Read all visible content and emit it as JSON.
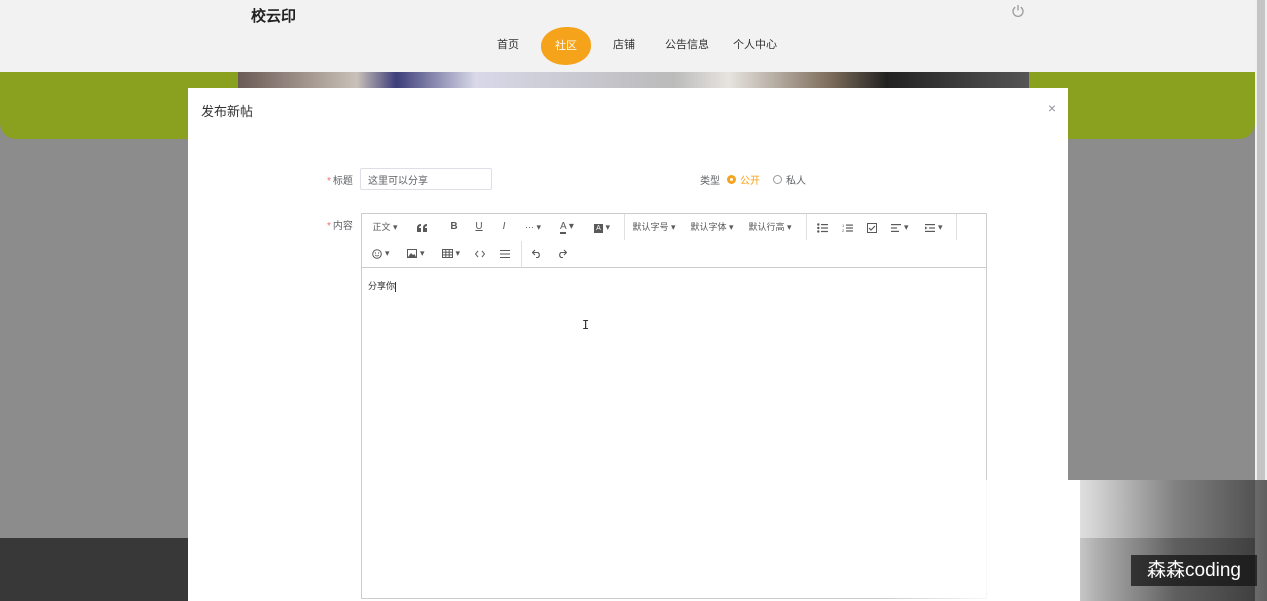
{
  "site": {
    "brand": "校云印",
    "nav": [
      {
        "label": "首页"
      },
      {
        "label": "社区",
        "active": true
      },
      {
        "label": "店铺"
      },
      {
        "label": "公告信息"
      },
      {
        "label": "个人中心"
      }
    ],
    "icons": {
      "power": "power-icon"
    }
  },
  "modal": {
    "title": "发布新帖",
    "close": "×",
    "title_label": "标题",
    "title_value": "这里可以分享",
    "type_label": "类型",
    "type_options": [
      {
        "label": "公开",
        "selected": true
      },
      {
        "label": "私人",
        "selected": false
      }
    ],
    "content_label": "内容",
    "required_mark": "*",
    "toolbar": {
      "heading": "正文",
      "more": "···",
      "font_size": "默认字号",
      "font_family": "默认字体",
      "line_height": "默认行高",
      "icons": [
        "quote-icon",
        "bold-icon",
        "underline-icon",
        "italic-icon",
        "more-icon",
        "font-color-icon",
        "bg-color-icon",
        "bullet-list-icon",
        "numbered-list-icon",
        "todo-icon",
        "align-icon",
        "indent-icon",
        "emoji-icon",
        "image-icon",
        "table-icon",
        "code-icon",
        "divider-icon",
        "undo-icon",
        "redo-icon"
      ]
    },
    "content_text": "分享你"
  },
  "watermark": "森森coding",
  "colors": {
    "accent": "#f5a31a",
    "green": "#8aa11f",
    "required": "#f56c6c"
  }
}
